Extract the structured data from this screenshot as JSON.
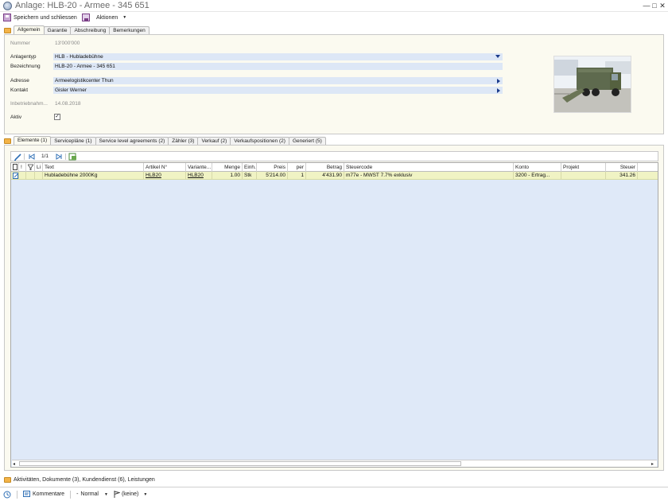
{
  "window": {
    "title": "Anlage: HLB-20 - Armee - 345 651"
  },
  "toolbar": {
    "save_close_label": "Speichern und schliessen",
    "actions_label": "Aktionen"
  },
  "top_tabs": [
    {
      "label": "Allgemein",
      "active": true
    },
    {
      "label": "Garantie"
    },
    {
      "label": "Abschreibung"
    },
    {
      "label": "Bemerkungen"
    }
  ],
  "form": {
    "nummer_label": "Nummer",
    "nummer_value": "13'000'000",
    "anlagentyp_label": "Anlagentyp",
    "anlagentyp_value": "HLB - Hubladebühne",
    "bezeichnung_label": "Bezeichnung",
    "bezeichnung_value": "HLB-20 - Armee - 345 651",
    "adresse_label": "Adresse",
    "adresse_value": "Armeelogistikcenter Thun",
    "kontakt_label": "Kontakt",
    "kontakt_value": "Gisler Werner",
    "inbetrieb_label": "Inbetriebnahm...",
    "inbetrieb_value": "14.08.2018",
    "aktiv_label": "Aktiv",
    "aktiv_checked": "✓"
  },
  "bottom_tabs": [
    {
      "label": "Elemente (1)",
      "active": true
    },
    {
      "label": "Servicepläne (1)"
    },
    {
      "label": "Service level agreements (2)"
    },
    {
      "label": "Zähler (3)"
    },
    {
      "label": "Verkauf (2)"
    },
    {
      "label": "Verkaufspositionen (2)"
    },
    {
      "label": "Generiert (5)"
    }
  ],
  "grid_toolbar": {
    "pager": "1/1"
  },
  "grid": {
    "columns": [
      "!",
      "Li",
      "Text",
      "Artikel N°",
      "Variante...",
      "Menge",
      "Einh.",
      "Preis",
      "per",
      "Betrag",
      "Steuercode",
      "Konto",
      "Projekt",
      "Steuer"
    ],
    "rows": [
      {
        "text": "Hubladebühne 2000Kg",
        "artikel": "HLB20",
        "variante": "HLB20",
        "menge": "1.00",
        "einh": "Stk",
        "preis": "5'214.00",
        "per": "1",
        "betrag": "4'431.90",
        "steuercode": "m77e  -  MWST 7.7% exklusiv",
        "konto": "3200  -  Ertrag...",
        "projekt": "",
        "steuer": "341.26"
      }
    ]
  },
  "bottom_bar": {
    "label": "Aktivitäten, Dokumente (3), Kundendienst (6), Leistungen"
  },
  "status": {
    "comments_label": "Kommentare",
    "priority_label": "Normal",
    "flag_label": "(keine)"
  }
}
